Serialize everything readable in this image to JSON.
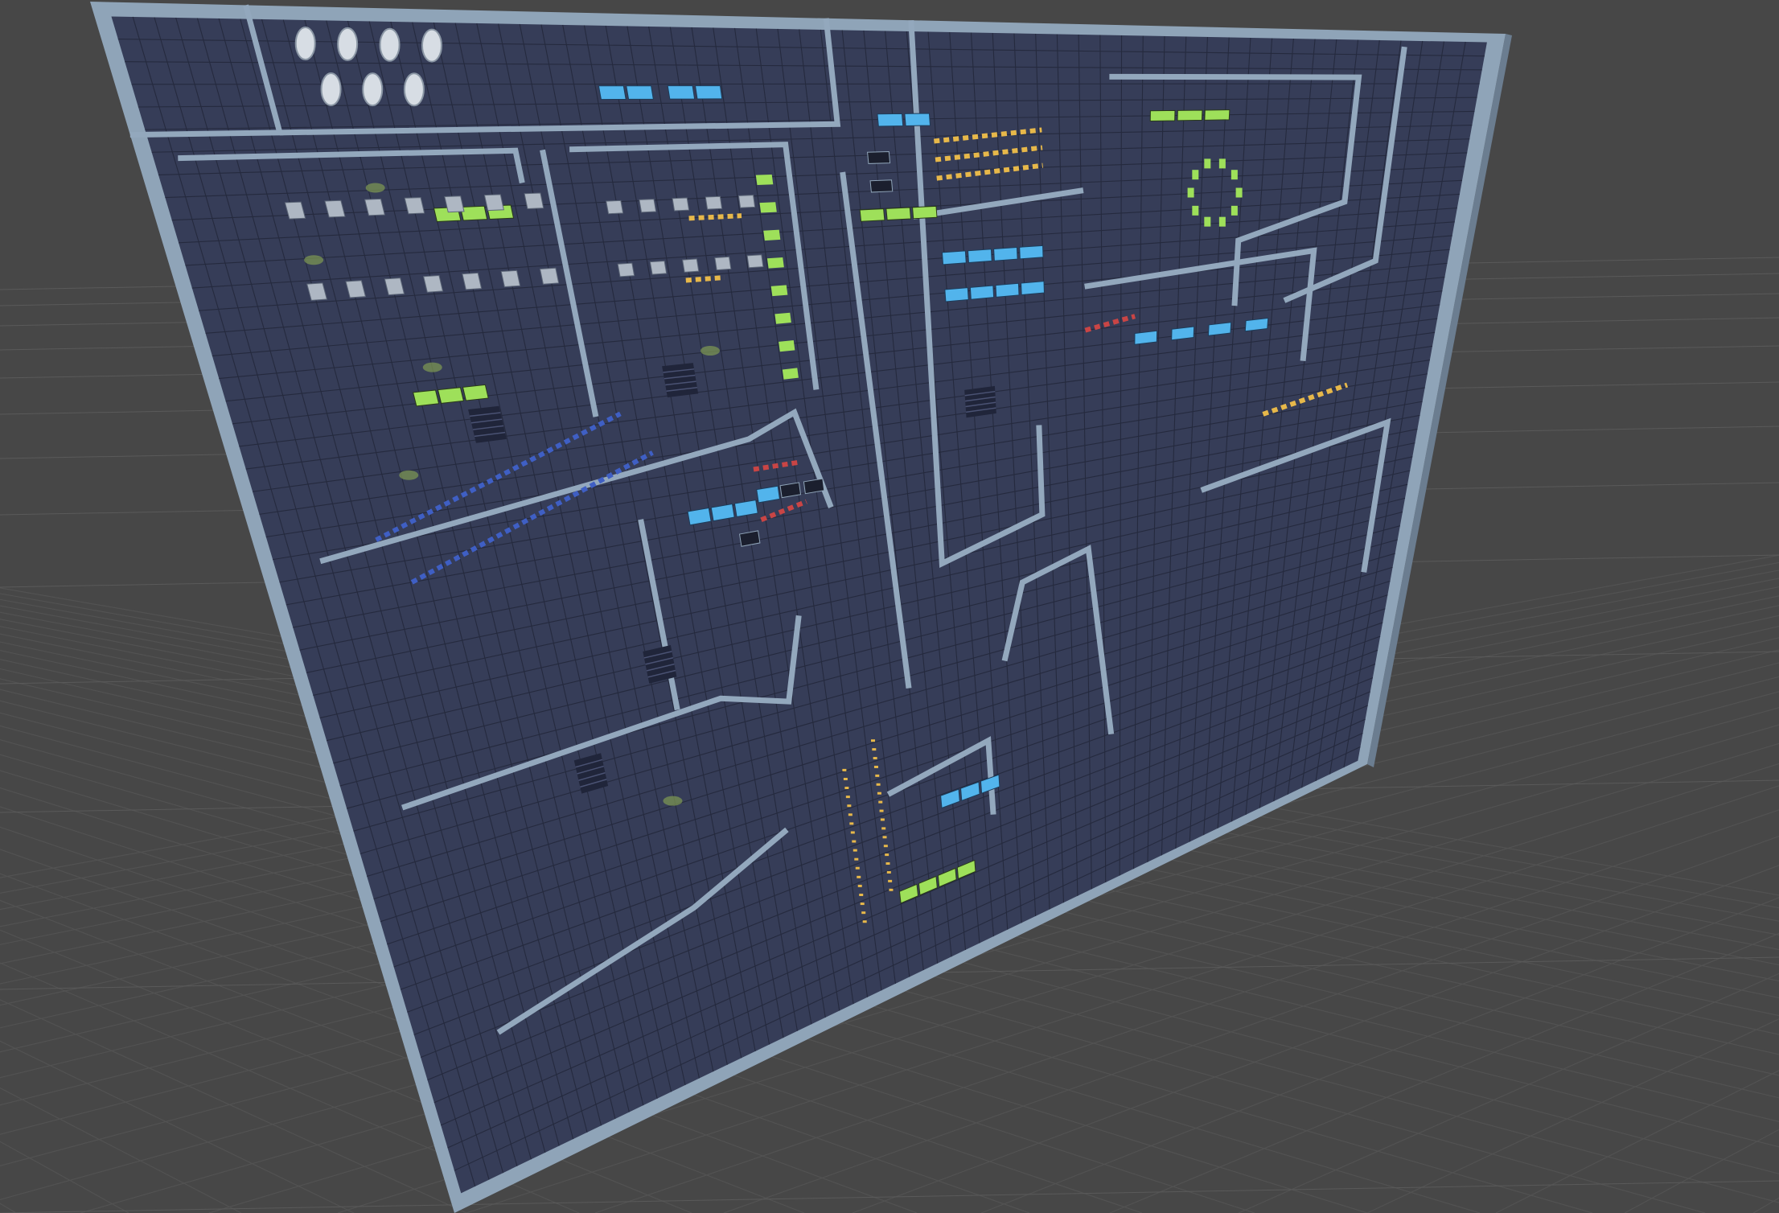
{
  "scene": {
    "view": "3d-perspective-viewport",
    "ground_grid": "visible",
    "object": "sci-fi-tilemap-wall-panel"
  },
  "colors": {
    "background": "#474747",
    "ground_grid_line": "#5a5a5a",
    "ground_grid_line_faint": "#525252",
    "panel_frame": "#8fa4b8",
    "panel_frame_shadow": "#6b7d90",
    "panel_base": "#363d58",
    "panel_tile_line": "#252a3e",
    "panel_tile_highlight": "#434b6a",
    "room_border": "#93a8bd",
    "screen_green": "#9ee05a",
    "screen_blue": "#52b4ec",
    "screen_dark": "#1b1f2e",
    "stripe_yellow": "#e7b84a",
    "stripe_blue": "#3f5fc4",
    "stripe_red": "#c94545",
    "can_white": "#d7dde4",
    "moss_green": "#7f9a52"
  },
  "details": {
    "icons": [
      "green-screen-icon",
      "blue-screen-icon",
      "dark-screen-icon",
      "cylinder-icon",
      "vent-grate-icon",
      "hazard-stripe-icon",
      "crate-icon"
    ]
  }
}
